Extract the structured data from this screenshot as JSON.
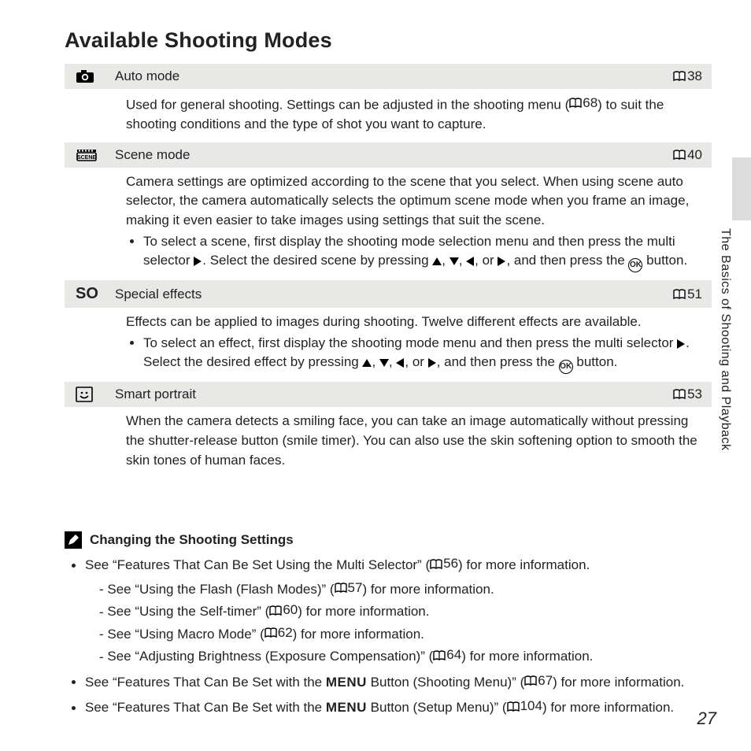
{
  "title": "Available Shooting Modes",
  "side_label": "The Basics of Shooting and Playback",
  "page_number": "27",
  "modes": [
    {
      "icon": "camera-icon",
      "name": "Auto mode",
      "ref": "38",
      "desc_pre": "Used for general shooting. Settings can be adjusted in the shooting menu (",
      "desc_ref": "68",
      "desc_post": ") to suit the shooting conditions and the type of shot you want to capture."
    },
    {
      "icon": "scene-icon",
      "name": "Scene mode",
      "ref": "40",
      "desc": "Camera settings are optimized according to the scene that you select. When using scene auto selector, the camera automatically selects the optimum scene mode when you frame an image, making it even easier to take images using settings that suit the scene.",
      "bullet_pre": "To select a scene, first display the shooting mode selection menu and then press the multi selector ",
      "bullet_mid": ". Select the desired scene by pressing ",
      "bullet_post": ", and then press the ",
      "bullet_end": " button."
    },
    {
      "icon": "so-icon",
      "name": "Special effects",
      "ref": "51",
      "desc": "Effects can be applied to images during shooting. Twelve different effects are available.",
      "bullet_pre": "To select an effect, first display the shooting mode menu and then press the multi selector ",
      "bullet_mid": ". Select the desired effect by pressing ",
      "bullet_post": ", and then press the ",
      "bullet_end": " button."
    },
    {
      "icon": "smile-portrait-icon",
      "name": "Smart portrait",
      "ref": "53",
      "desc": "When the camera detects a smiling face, you can take an image automatically without pressing the shutter-release button (smile timer). You can also use the skin softening option to smooth the skin tones of human faces."
    }
  ],
  "note": {
    "heading": "Changing the Shooting Settings",
    "items": [
      {
        "text_pre": "See “Features That Can Be Set Using the Multi Selector” (",
        "ref": "56",
        "text_post": ") for more information.",
        "subs": [
          {
            "pre": "See “Using the Flash (Flash Modes)” (",
            "ref": "57",
            "post": ") for more information."
          },
          {
            "pre": "See “Using the Self-timer” (",
            "ref": "60",
            "post": ") for more information."
          },
          {
            "pre": "See “Using Macro Mode” (",
            "ref": "62",
            "post": ") for more information."
          },
          {
            "pre": "See “Adjusting Brightness (Exposure Compensation)” (",
            "ref": "64",
            "post": ") for more information."
          }
        ]
      },
      {
        "text_pre": "See “Features That Can Be Set with the ",
        "menu": "MENU",
        "text_mid": " Button (Shooting Menu)” (",
        "ref": "67",
        "text_post": ") for more information."
      },
      {
        "text_pre": "See “Features That Can Be Set with the ",
        "menu": "MENU",
        "text_mid": " Button (Setup Menu)” (",
        "ref": "104",
        "text_post": ") for more information."
      }
    ]
  }
}
